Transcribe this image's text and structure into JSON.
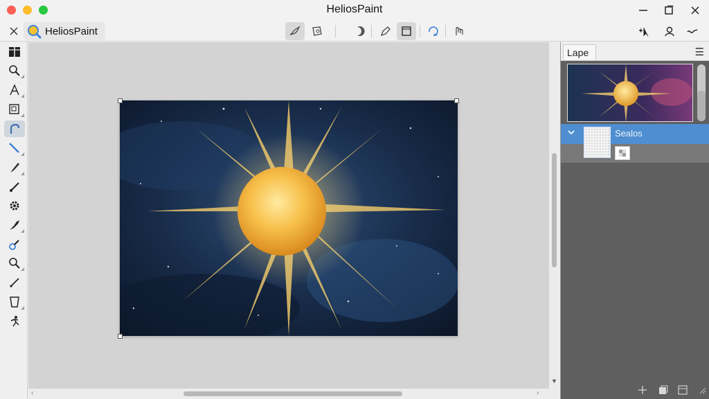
{
  "window": {
    "title": "HeliosPaint"
  },
  "toolbar": {
    "app_name": "HeliosPaint",
    "icons": [
      "collapse-icon",
      "app-logo-icon",
      "brush-settings-icon",
      "transform-icon",
      "crescent-icon",
      "pen-icon",
      "frame-icon",
      "rotate-icon",
      "gesture-icon",
      "cursor-add-icon",
      "user-icon",
      "wave-icon"
    ]
  },
  "tools": {
    "items": [
      "panel-icon",
      "zoom-icon",
      "text-icon",
      "crop-icon",
      "lasso-icon",
      "line-icon",
      "brush-icon",
      "pencil-icon",
      "gear-icon",
      "fill-icon",
      "eyedropper-icon",
      "magnifier-icon",
      "pen-icon",
      "bucket-icon",
      "figure-icon"
    ],
    "active_index": 4
  },
  "layers_panel": {
    "tab_label": "Lape",
    "layer_name": "Sealos"
  },
  "colors": {
    "accent": "#4f8ed1",
    "panel_bg": "#5f5f5f",
    "canvas_bg": "#d3d3d3"
  }
}
